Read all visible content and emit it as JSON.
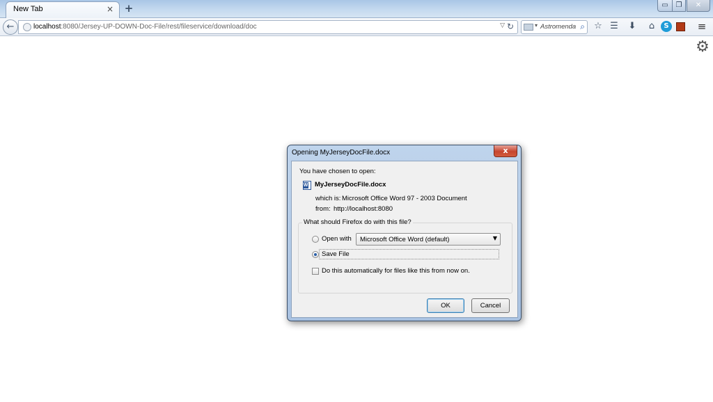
{
  "browser": {
    "tab_title": "New Tab",
    "tab_close": "×",
    "new_tab": "+",
    "url_host": "localhost",
    "url_rest": ":8080/Jersey-UP-DOWN-Doc-File/rest/fileservice/download/doc",
    "search_placeholder": "Astromenda",
    "window_buttons": {
      "minimize": "▭",
      "maximize": "❐",
      "close": "✕"
    }
  },
  "toolbar_icons": [
    "back-icon",
    "bookmark-star-icon",
    "reading-list-icon",
    "downloads-icon",
    "home-icon",
    "skype-icon",
    "addon-icon",
    "menu-icon"
  ],
  "dialog": {
    "title": "Opening MyJerseyDocFile.docx",
    "close_label": "x",
    "intro": "You have chosen to open:",
    "file_name": "MyJerseyDocFile.docx",
    "which_is_label": "which is:",
    "which_is_value": "Microsoft Office Word 97 - 2003 Document",
    "from_label": "from:",
    "from_value": "http://localhost:8080",
    "question": "What should Firefox do with this file?",
    "open_with_label": "Open with",
    "open_with_app": "Microsoft Office Word (default)",
    "save_file_label": "Save File",
    "selected_option": "Save File",
    "auto_label": "Do this automatically for files like this from now on.",
    "auto_checked": false,
    "ok_label": "OK",
    "cancel_label": "Cancel"
  },
  "colors": {
    "dialog_frame": "#a9c2e1",
    "close_button": "#c6452f",
    "ok_focus": "#3c7fb1"
  }
}
